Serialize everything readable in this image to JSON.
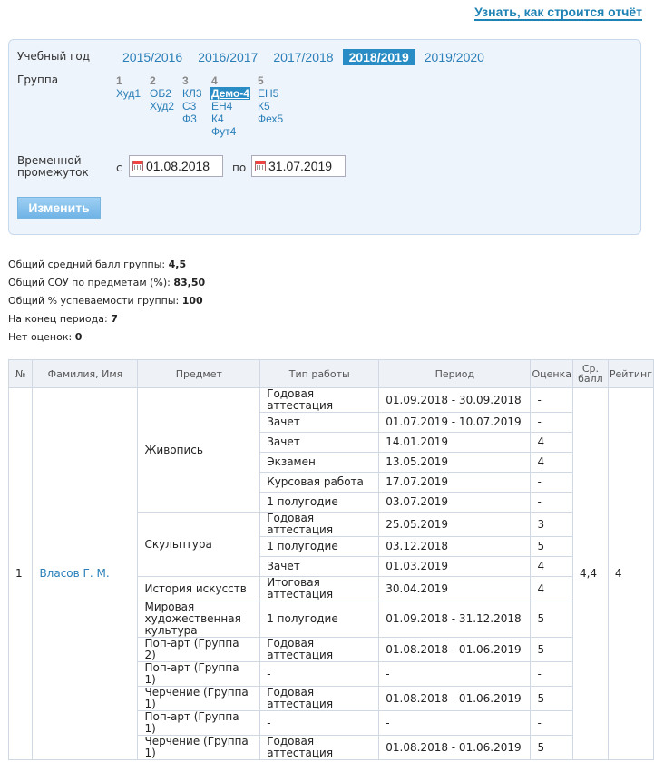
{
  "header": {
    "how_link": "Узнать, как строится отчёт"
  },
  "filter": {
    "year_label": "Учебный год",
    "years": [
      {
        "label": "2015/2016",
        "selected": false
      },
      {
        "label": "2016/2017",
        "selected": false
      },
      {
        "label": "2017/2018",
        "selected": false
      },
      {
        "label": "2018/2019",
        "selected": true
      },
      {
        "label": "2019/2020",
        "selected": false
      }
    ],
    "group_label": "Группа",
    "groups": [
      {
        "num": "1",
        "items": [
          "Худ1"
        ]
      },
      {
        "num": "2",
        "items": [
          "ОБ2",
          "Худ2"
        ]
      },
      {
        "num": "3",
        "items": [
          "КЛ3",
          "С3",
          "Ф3"
        ]
      },
      {
        "num": "4",
        "items": [
          "Демо-4",
          "ЕН4",
          "К4",
          "Фут4"
        ]
      },
      {
        "num": "5",
        "items": [
          "ЕН5",
          "К5",
          "Фех5"
        ]
      }
    ],
    "selected_group": "Демо-4",
    "period_label_1": "Временной",
    "period_label_2": "промежуток",
    "from_label": "с",
    "from_date": "01.08.2018",
    "to_label": "по",
    "to_date": "31.07.2019",
    "apply_button": "Изменить"
  },
  "stats": [
    {
      "label": "Общий средний балл группы:",
      "value": "4,5"
    },
    {
      "label": "Общий СОУ по предметам (%):",
      "value": "83,50"
    },
    {
      "label": "Общий % успеваемости группы:",
      "value": "100"
    },
    {
      "label": "На конец периода:",
      "value": "7"
    },
    {
      "label": "Нет оценок:",
      "value": "0"
    }
  ],
  "table": {
    "headers": {
      "num": "№",
      "name": "Фамилия, Имя",
      "subject": "Предмет",
      "work_type": "Тип работы",
      "period": "Период",
      "grade": "Оценка",
      "avg_1": "Ср.",
      "avg_2": "балл",
      "rating": "Рейтинг"
    },
    "student": {
      "num": "1",
      "name": "Власов Г. М.",
      "avg": "4,4",
      "rating": "4"
    },
    "subjects": [
      {
        "name": "Живопись",
        "rows": [
          {
            "type": "Годовая аттестация",
            "period": "01.09.2018 - 30.09.2018",
            "grade": "-"
          },
          {
            "type": "Зачет",
            "period": "01.07.2019 - 10.07.2019",
            "grade": "-"
          },
          {
            "type": "Зачет",
            "period": "14.01.2019",
            "grade": "4"
          },
          {
            "type": "Экзамен",
            "period": "13.05.2019",
            "grade": "4"
          },
          {
            "type": "Курсовая работа",
            "period": "17.07.2019",
            "grade": "-"
          },
          {
            "type": "1 полугодие",
            "period": "03.07.2019",
            "grade": "-"
          }
        ]
      },
      {
        "name": "Скульптура",
        "rows": [
          {
            "type": "Годовая аттестация",
            "period": "25.05.2019",
            "grade": "3"
          },
          {
            "type": "1 полугодие",
            "period": "03.12.2018",
            "grade": "5"
          },
          {
            "type": "Зачет",
            "period": "01.03.2019",
            "grade": "4"
          }
        ]
      },
      {
        "name": "История искусств",
        "rows": [
          {
            "type": "Итоговая аттестация",
            "period": "30.04.2019",
            "grade": "4"
          }
        ]
      },
      {
        "name": "Мировая художественная культура",
        "rows": [
          {
            "type": "1 полугодие",
            "period": "01.09.2018 - 31.12.2018",
            "grade": "5"
          }
        ]
      },
      {
        "name": "Поп-арт (Группа 2)",
        "rows": [
          {
            "type": "Годовая аттестация",
            "period": "01.08.2018 - 01.06.2019",
            "grade": "5"
          }
        ]
      },
      {
        "name": "Поп-арт (Группа 1)",
        "rows": [
          {
            "type": "-",
            "period": "-",
            "grade": "-"
          }
        ]
      },
      {
        "name": "Черчение (Группа 1)",
        "rows": [
          {
            "type": "Годовая аттестация",
            "period": "01.08.2018 - 01.06.2019",
            "grade": "5"
          }
        ]
      },
      {
        "name": "Поп-арт (Группа 1)",
        "rows": [
          {
            "type": "-",
            "period": "-",
            "grade": "-"
          }
        ]
      },
      {
        "name": "Черчение (Группа 1)",
        "rows": [
          {
            "type": "Годовая аттестация",
            "period": "01.08.2018 - 01.06.2019",
            "grade": "5"
          }
        ]
      }
    ]
  }
}
